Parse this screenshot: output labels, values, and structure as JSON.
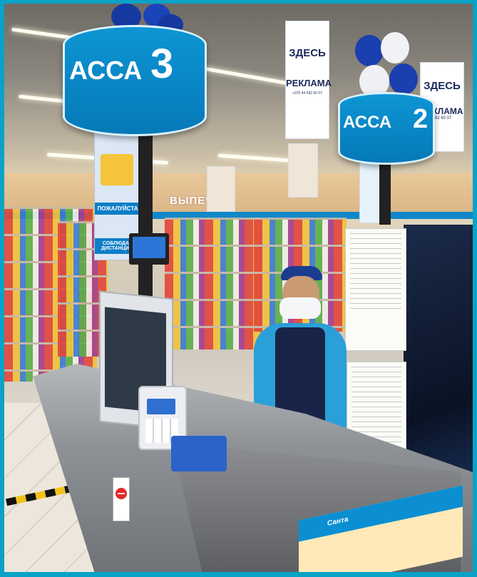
{
  "photo": {
    "kassa_left": {
      "prefix": "АССА",
      "number": "3"
    },
    "kassa_right": {
      "prefix": "АССА",
      "number": "2"
    },
    "ad_poster": {
      "line1": "ЗДЕСЬ",
      "line2": "РЕКЛАМА",
      "phone": "+375 44 592 60 07"
    },
    "ad_poster_right": {
      "line1": "ЗДЕСЬ",
      "line2": "РЕКЛАМА",
      "phone": "592 60 07"
    },
    "left_banner": {
      "top": "ПОЖАЛУЙСТА",
      "bottom": "СОБЛЮДАЙ ДИСТАНЦИЮ"
    },
    "bakery_sign": "ВЫПЕЧ",
    "menu_brochure": "Санта",
    "colors": {
      "accent": "#0d95d4",
      "frame": "#0aa2c6",
      "uniform": "#2a9fd8"
    }
  }
}
